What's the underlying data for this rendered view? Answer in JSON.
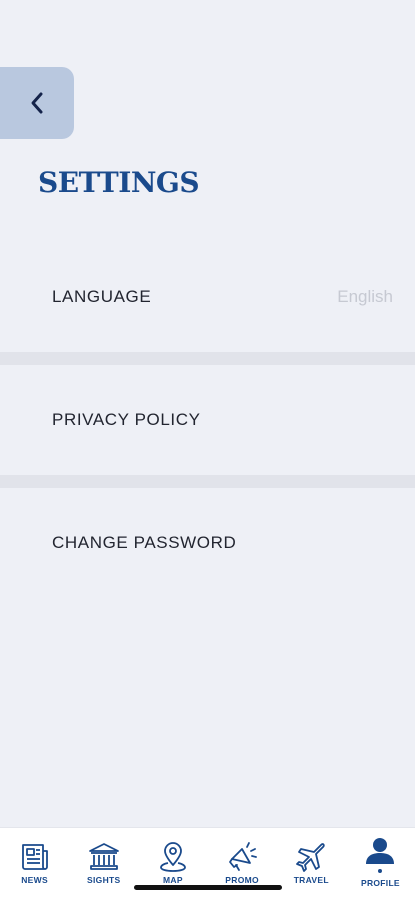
{
  "header": {
    "title": "SETTINGS"
  },
  "settings": {
    "items": [
      {
        "label": "LANGUAGE",
        "value": "English"
      },
      {
        "label": "PRIVACY POLICY"
      },
      {
        "label": "CHANGE PASSWORD"
      }
    ]
  },
  "tab_bar": {
    "tabs": [
      {
        "label": "NEWS",
        "icon": "newspaper-icon"
      },
      {
        "label": "SIGHTS",
        "icon": "landmark-icon"
      },
      {
        "label": "MAP",
        "icon": "map-pin-icon"
      },
      {
        "label": "PROMO",
        "icon": "megaphone-icon"
      },
      {
        "label": "TRAVEL",
        "icon": "airplane-icon"
      },
      {
        "label": "PROFILE",
        "icon": "user-icon"
      }
    ],
    "active": "PROFILE"
  },
  "colors": {
    "background": "#eef0f6",
    "accent": "#1a4a8c",
    "back_button": "#b9c8df",
    "value_text": "#c6c9d2"
  }
}
